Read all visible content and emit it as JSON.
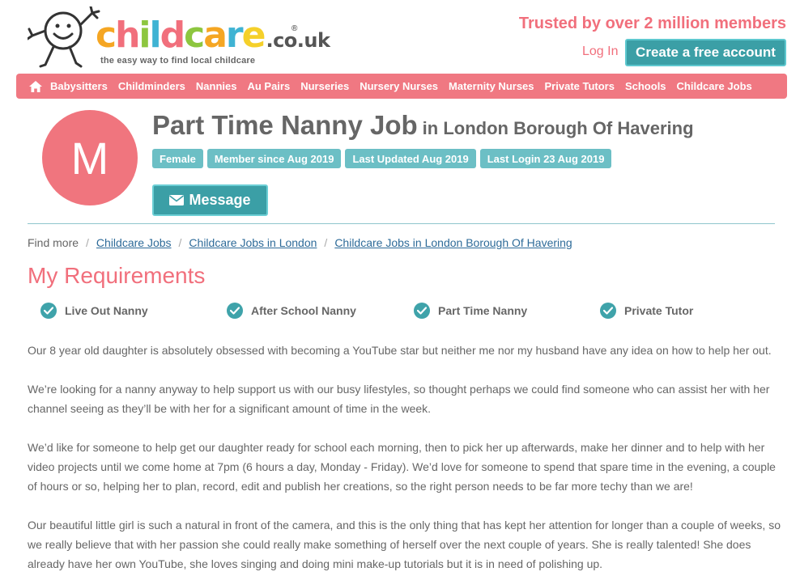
{
  "logo": {
    "letters": [
      {
        "ch": "c",
        "color": "#f5a623"
      },
      {
        "ch": "h",
        "color": "#f16f7c"
      },
      {
        "ch": "i",
        "color": "#8dc63f"
      },
      {
        "ch": "l",
        "color": "#3fb3d3"
      },
      {
        "ch": "d",
        "color": "#f16f7c"
      },
      {
        "ch": "c",
        "color": "#8dc63f"
      },
      {
        "ch": "a",
        "color": "#f5a623"
      },
      {
        "ch": "r",
        "color": "#3fb3d3"
      },
      {
        "ch": "e",
        "color": "#f5d02a"
      }
    ],
    "domain": ".co.uk",
    "registered": "®",
    "tagline": "the easy way to find local childcare"
  },
  "header": {
    "trusted": "Trusted by over 2 million members",
    "login": "Log In",
    "create_account": "Create a free account"
  },
  "nav": {
    "home_icon": "home-icon",
    "items": [
      "Babysitters",
      "Childminders",
      "Nannies",
      "Au Pairs",
      "Nurseries",
      "Nursery Nurses",
      "Maternity Nurses",
      "Private Tutors",
      "Schools",
      "Childcare Jobs"
    ]
  },
  "profile": {
    "avatar_letter": "M",
    "title": "Part Time Nanny Job",
    "location": "in London Borough Of Havering",
    "badges": [
      "Female",
      "Member since Aug 2019",
      "Last Updated Aug 2019",
      "Last Login 23 Aug 2019"
    ],
    "message_button": "Message",
    "message_icon": "envelope-icon"
  },
  "breadcrumb": {
    "prefix": "Find more",
    "separator": "/",
    "links": [
      "Childcare Jobs",
      "Childcare Jobs in London",
      "Childcare Jobs in London Borough Of Havering"
    ]
  },
  "requirements": {
    "title": "My Requirements",
    "items": [
      "Live Out Nanny",
      "After School Nanny",
      "Part Time Nanny",
      "Private Tutor"
    ]
  },
  "description": {
    "paragraphs": [
      "Our 8 year old daughter is absolutely obsessed with becoming a YouTube star but neither me nor my husband have any idea on how to help her out.",
      "We’re looking for a nanny anyway to help support us with our busy lifestyles, so thought perhaps we could find someone who can assist her with her channel seeing as they’ll be with her for a significant amount of time in the week.",
      "We’d like for someone to help get our daughter ready for school each morning, then to pick her up afterwards, make her dinner and to help with her video projects until we come home at 7pm (6 hours a day, Monday - Friday). We’d love for someone to spend that spare time in the evening, a couple of hours or so, helping her to plan, record, edit and publish her creations, so the right person needs to be far more techy than we are!",
      "Our beautiful little girl is such a natural in front of the camera, and this is the only thing that has kept her attention for longer than a couple of weeks, so we really believe that with her passion she could really make something of herself over the next couple of years. She is really talented! She does already have her own YouTube, she loves singing and doing mini make-up tutorials but it is in need of polishing up."
    ]
  },
  "colors": {
    "brand_pink": "#f16f7c",
    "brand_teal": "#3b9fa6",
    "badge_teal": "#6cbfc5"
  }
}
